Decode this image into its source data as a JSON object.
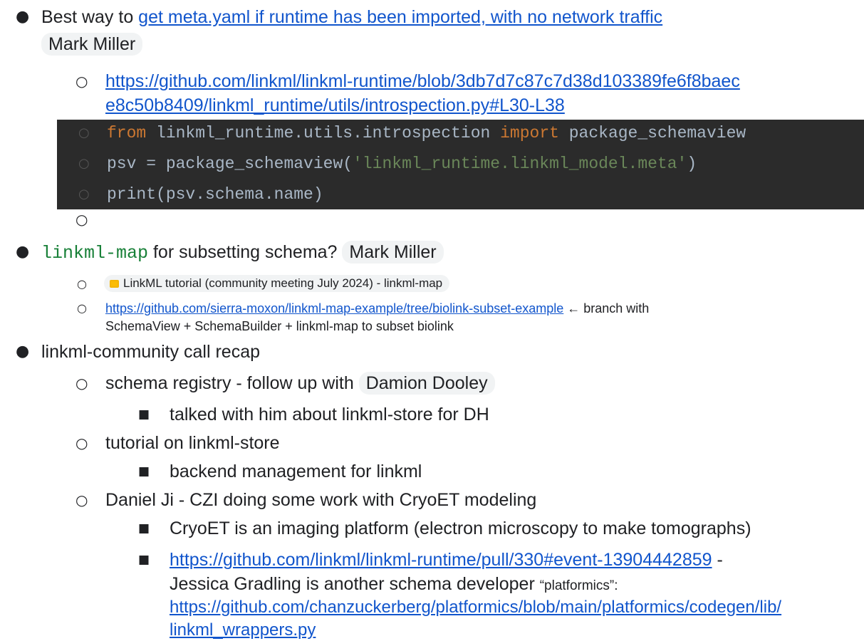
{
  "item1": {
    "prefix": "Best way to ",
    "link": "get meta.yaml if runtime has been imported, with no network traffic",
    "person": "Mark Miller",
    "sub_link_line1": "https://github.com/linkml/linkml-runtime/blob/3db7d7c87c7d38d103389fe6f8baec",
    "sub_link_line2": "e8c50b8409/linkml_runtime/utils/introspection.py#L30-L38",
    "code": {
      "line1": {
        "kw1": "from",
        "mid": " linkml_runtime.utils.introspection ",
        "kw2": "import",
        "rest": " package_schemaview"
      },
      "line2": {
        "pre": "psv = package_schemaview(",
        "str": "'linkml_runtime.linkml_model.meta'",
        "post": ")"
      },
      "line3": "print(psv.schema.name)"
    }
  },
  "item2": {
    "code": "linkml-map",
    "text": " for subsetting schema?",
    "person": "Mark Miller",
    "chip_title": "LinkML tutorial (community meeting July 2024) - linkml-map",
    "sub_link": "https://github.com/sierra-moxon/linkml-map-example/tree/biolink-subset-example",
    "sub_text1": " ← branch with",
    "sub_text2": "SchemaView + SchemaBuilder + linkml-map to subset biolink"
  },
  "item3": {
    "text": "linkml-community call recap",
    "sub1_text": "schema registry - follow up with ",
    "sub1_person": "Damion Dooley",
    "sub1_child": "talked with him about linkml-store for DH",
    "sub2_text": "tutorial on linkml-store",
    "sub2_child": "backend management for linkml",
    "sub3_text": "Daniel Ji - CZI doing some work with CryoET modeling",
    "sub3_child1": "CryoET is an imaging platform (electron microscopy to make tomographs)",
    "sub3_child2_link": "https://github.com/linkml/linkml-runtime/pull/330#event-13904442859",
    "sub3_child2_text1": " -",
    "sub3_child2_text2": "Jessica Gradling is another schema developer ",
    "sub3_child2_quote": "“platformics”:",
    "sub3_child2_link2_line1": "https://github.com/chanzuckerberg/platformics/blob/main/platformics/codegen/lib/",
    "sub3_child2_link2_line2": "linkml_wrappers.py"
  }
}
